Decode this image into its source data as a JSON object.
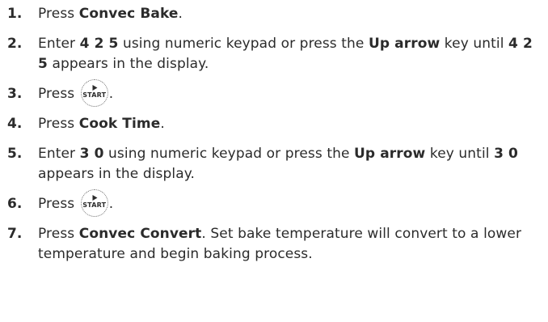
{
  "steps": [
    {
      "num": "1.",
      "t1": "Press ",
      "b1": "Convec Bake",
      "t2": "."
    },
    {
      "num": "2.",
      "t1": "Enter ",
      "b1": "4 2 5",
      "t2": " using numeric keypad or press the ",
      "b2": "Up arrow",
      "t3": " key until ",
      "b3": "4 2 5",
      "t4": " appears in the display."
    },
    {
      "num": "3.",
      "t1": "Press ",
      "button_label": "START",
      "t2": "."
    },
    {
      "num": "4.",
      "t1": "Press ",
      "b1": "Cook Time",
      "t2": "."
    },
    {
      "num": "5.",
      "t1": "Enter ",
      "b1": "3 0",
      "t2": " using numeric keypad or press the ",
      "b2": "Up arrow",
      "t3": " key until ",
      "b3": "3 0",
      "t4": " appears in the display."
    },
    {
      "num": "6.",
      "t1": "Press ",
      "button_label": "START",
      "t2": "."
    },
    {
      "num": "7.",
      "t1": "Press ",
      "b1": "Convec Convert",
      "t2": ". Set bake temperature will convert to a lower temperature and begin baking process."
    }
  ],
  "icons": {
    "start_button_icon": "play-triangle-icon"
  }
}
